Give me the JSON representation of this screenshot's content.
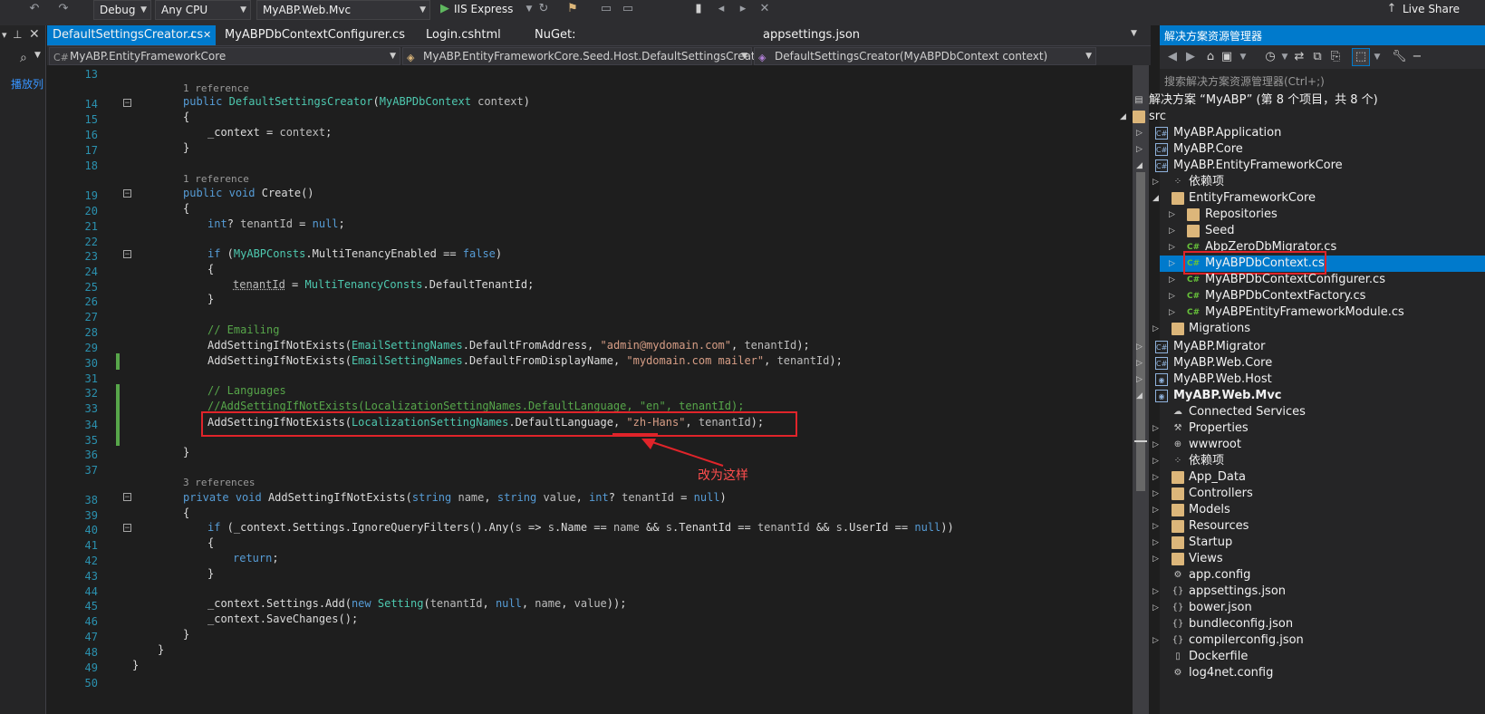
{
  "toolbar": {
    "config": "Debug",
    "platform": "Any CPU",
    "startup_project": "MyABP.Web.Mvc",
    "run_target": "IIS Express",
    "live_share": "Live Share"
  },
  "left_panel": {
    "label": "播放列"
  },
  "tabs": [
    {
      "label": "DefaultSettingsCreator.cs",
      "active": true
    },
    {
      "label": "MyABPDbContextConfigurer.cs",
      "active": false
    },
    {
      "label": "Login.cshtml",
      "active": false
    },
    {
      "label": "NuGet: MyABP.EntityFrameworkCore",
      "active": false
    },
    {
      "label": "appsettings.json",
      "active": false
    }
  ],
  "navbar": {
    "project": "MyABP.EntityFrameworkCore",
    "class": "MyABP.EntityFrameworkCore.Seed.Host.DefaultSettingsCreator",
    "member": "DefaultSettingsCreator(MyABPDbContext context)"
  },
  "code": {
    "line_numbers": [
      "13",
      "14",
      "15",
      "16",
      "17",
      "18",
      "19",
      "20",
      "21",
      "22",
      "23",
      "24",
      "25",
      "26",
      "27",
      "28",
      "29",
      "30",
      "31",
      "32",
      "33",
      "34",
      "35",
      "36",
      "37",
      "38",
      "39",
      "40",
      "41",
      "42",
      "43",
      "44",
      "45",
      "46",
      "47",
      "48",
      "49",
      "50"
    ],
    "ref1": "1 reference",
    "ref2": "1 reference",
    "ref3": "3 references",
    "annotation": "改为这样"
  },
  "solution_explorer": {
    "title": "解决方案资源管理器",
    "search_placeholder": "搜索解决方案资源管理器(Ctrl+;)",
    "items": [
      {
        "label": "解决方案 “MyABP” (第 8 个项目，共 8 个)",
        "icon": "solution-icon",
        "level": 0,
        "arrow": ""
      },
      {
        "label": "src",
        "icon": "folder-icon",
        "level": 0,
        "arrow": "expanded"
      },
      {
        "label": "MyABP.Application",
        "icon": "csproj-icon",
        "level": 1,
        "arrow": "collapsed"
      },
      {
        "label": "MyABP.Core",
        "icon": "csproj-icon",
        "level": 1,
        "arrow": "collapsed"
      },
      {
        "label": "MyABP.EntityFrameworkCore",
        "icon": "csproj-icon",
        "level": 1,
        "arrow": "expanded"
      },
      {
        "label": "依赖项",
        "icon": "dependencies-icon",
        "level": 2,
        "arrow": "collapsed"
      },
      {
        "label": "EntityFrameworkCore",
        "icon": "folder-open-icon",
        "level": 2,
        "arrow": "expanded"
      },
      {
        "label": "Repositories",
        "icon": "folder-icon",
        "level": 3,
        "arrow": "collapsed"
      },
      {
        "label": "Seed",
        "icon": "folder-icon",
        "level": 3,
        "arrow": "collapsed"
      },
      {
        "label": "AbpZeroDbMigrator.cs",
        "icon": "csharp-file-icon",
        "level": 3,
        "arrow": "collapsed"
      },
      {
        "label": "MyABPDbContext.cs",
        "icon": "csharp-file-icon",
        "level": 3,
        "arrow": "collapsed",
        "selected": true
      },
      {
        "label": "MyABPDbContextConfigurer.cs",
        "icon": "csharp-file-icon",
        "level": 3,
        "arrow": "collapsed"
      },
      {
        "label": "MyABPDbContextFactory.cs",
        "icon": "csharp-file-icon",
        "level": 3,
        "arrow": "collapsed"
      },
      {
        "label": "MyABPEntityFrameworkModule.cs",
        "icon": "csharp-file-icon",
        "level": 3,
        "arrow": "collapsed"
      },
      {
        "label": "Migrations",
        "icon": "folder-icon",
        "level": 2,
        "arrow": "collapsed"
      },
      {
        "label": "MyABP.Migrator",
        "icon": "csproj-icon",
        "level": 1,
        "arrow": "collapsed"
      },
      {
        "label": "MyABP.Web.Core",
        "icon": "csproj-icon",
        "level": 1,
        "arrow": "collapsed"
      },
      {
        "label": "MyABP.Web.Host",
        "icon": "web-project-icon",
        "level": 1,
        "arrow": "collapsed"
      },
      {
        "label": "MyABP.Web.Mvc",
        "icon": "web-project-icon",
        "level": 1,
        "arrow": "expanded",
        "bold": true
      },
      {
        "label": "Connected Services",
        "icon": "connected-services-icon",
        "level": 2,
        "arrow": ""
      },
      {
        "label": "Properties",
        "icon": "wrench-icon",
        "level": 2,
        "arrow": "collapsed"
      },
      {
        "label": "wwwroot",
        "icon": "globe-icon",
        "level": 2,
        "arrow": "collapsed"
      },
      {
        "label": "依赖项",
        "icon": "dependencies-icon",
        "level": 2,
        "arrow": "collapsed"
      },
      {
        "label": "App_Data",
        "icon": "folder-icon",
        "level": 2,
        "arrow": "collapsed"
      },
      {
        "label": "Controllers",
        "icon": "folder-icon",
        "level": 2,
        "arrow": "collapsed"
      },
      {
        "label": "Models",
        "icon": "folder-icon",
        "level": 2,
        "arrow": "collapsed"
      },
      {
        "label": "Resources",
        "icon": "folder-icon",
        "level": 2,
        "arrow": "collapsed"
      },
      {
        "label": "Startup",
        "icon": "folder-icon",
        "level": 2,
        "arrow": "collapsed"
      },
      {
        "label": "Views",
        "icon": "folder-icon",
        "level": 2,
        "arrow": "collapsed"
      },
      {
        "label": "app.config",
        "icon": "config-file-icon",
        "level": 2,
        "arrow": ""
      },
      {
        "label": "appsettings.json",
        "icon": "json-file-icon",
        "level": 2,
        "arrow": "collapsed"
      },
      {
        "label": "bower.json",
        "icon": "json-file-icon",
        "level": 2,
        "arrow": "collapsed"
      },
      {
        "label": "bundleconfig.json",
        "icon": "json-file-icon",
        "level": 2,
        "arrow": ""
      },
      {
        "label": "compilerconfig.json",
        "icon": "json-file-icon",
        "level": 2,
        "arrow": "collapsed"
      },
      {
        "label": "Dockerfile",
        "icon": "file-icon",
        "level": 2,
        "arrow": ""
      },
      {
        "label": "log4net.config",
        "icon": "config-file-icon",
        "level": 2,
        "arrow": ""
      }
    ]
  }
}
